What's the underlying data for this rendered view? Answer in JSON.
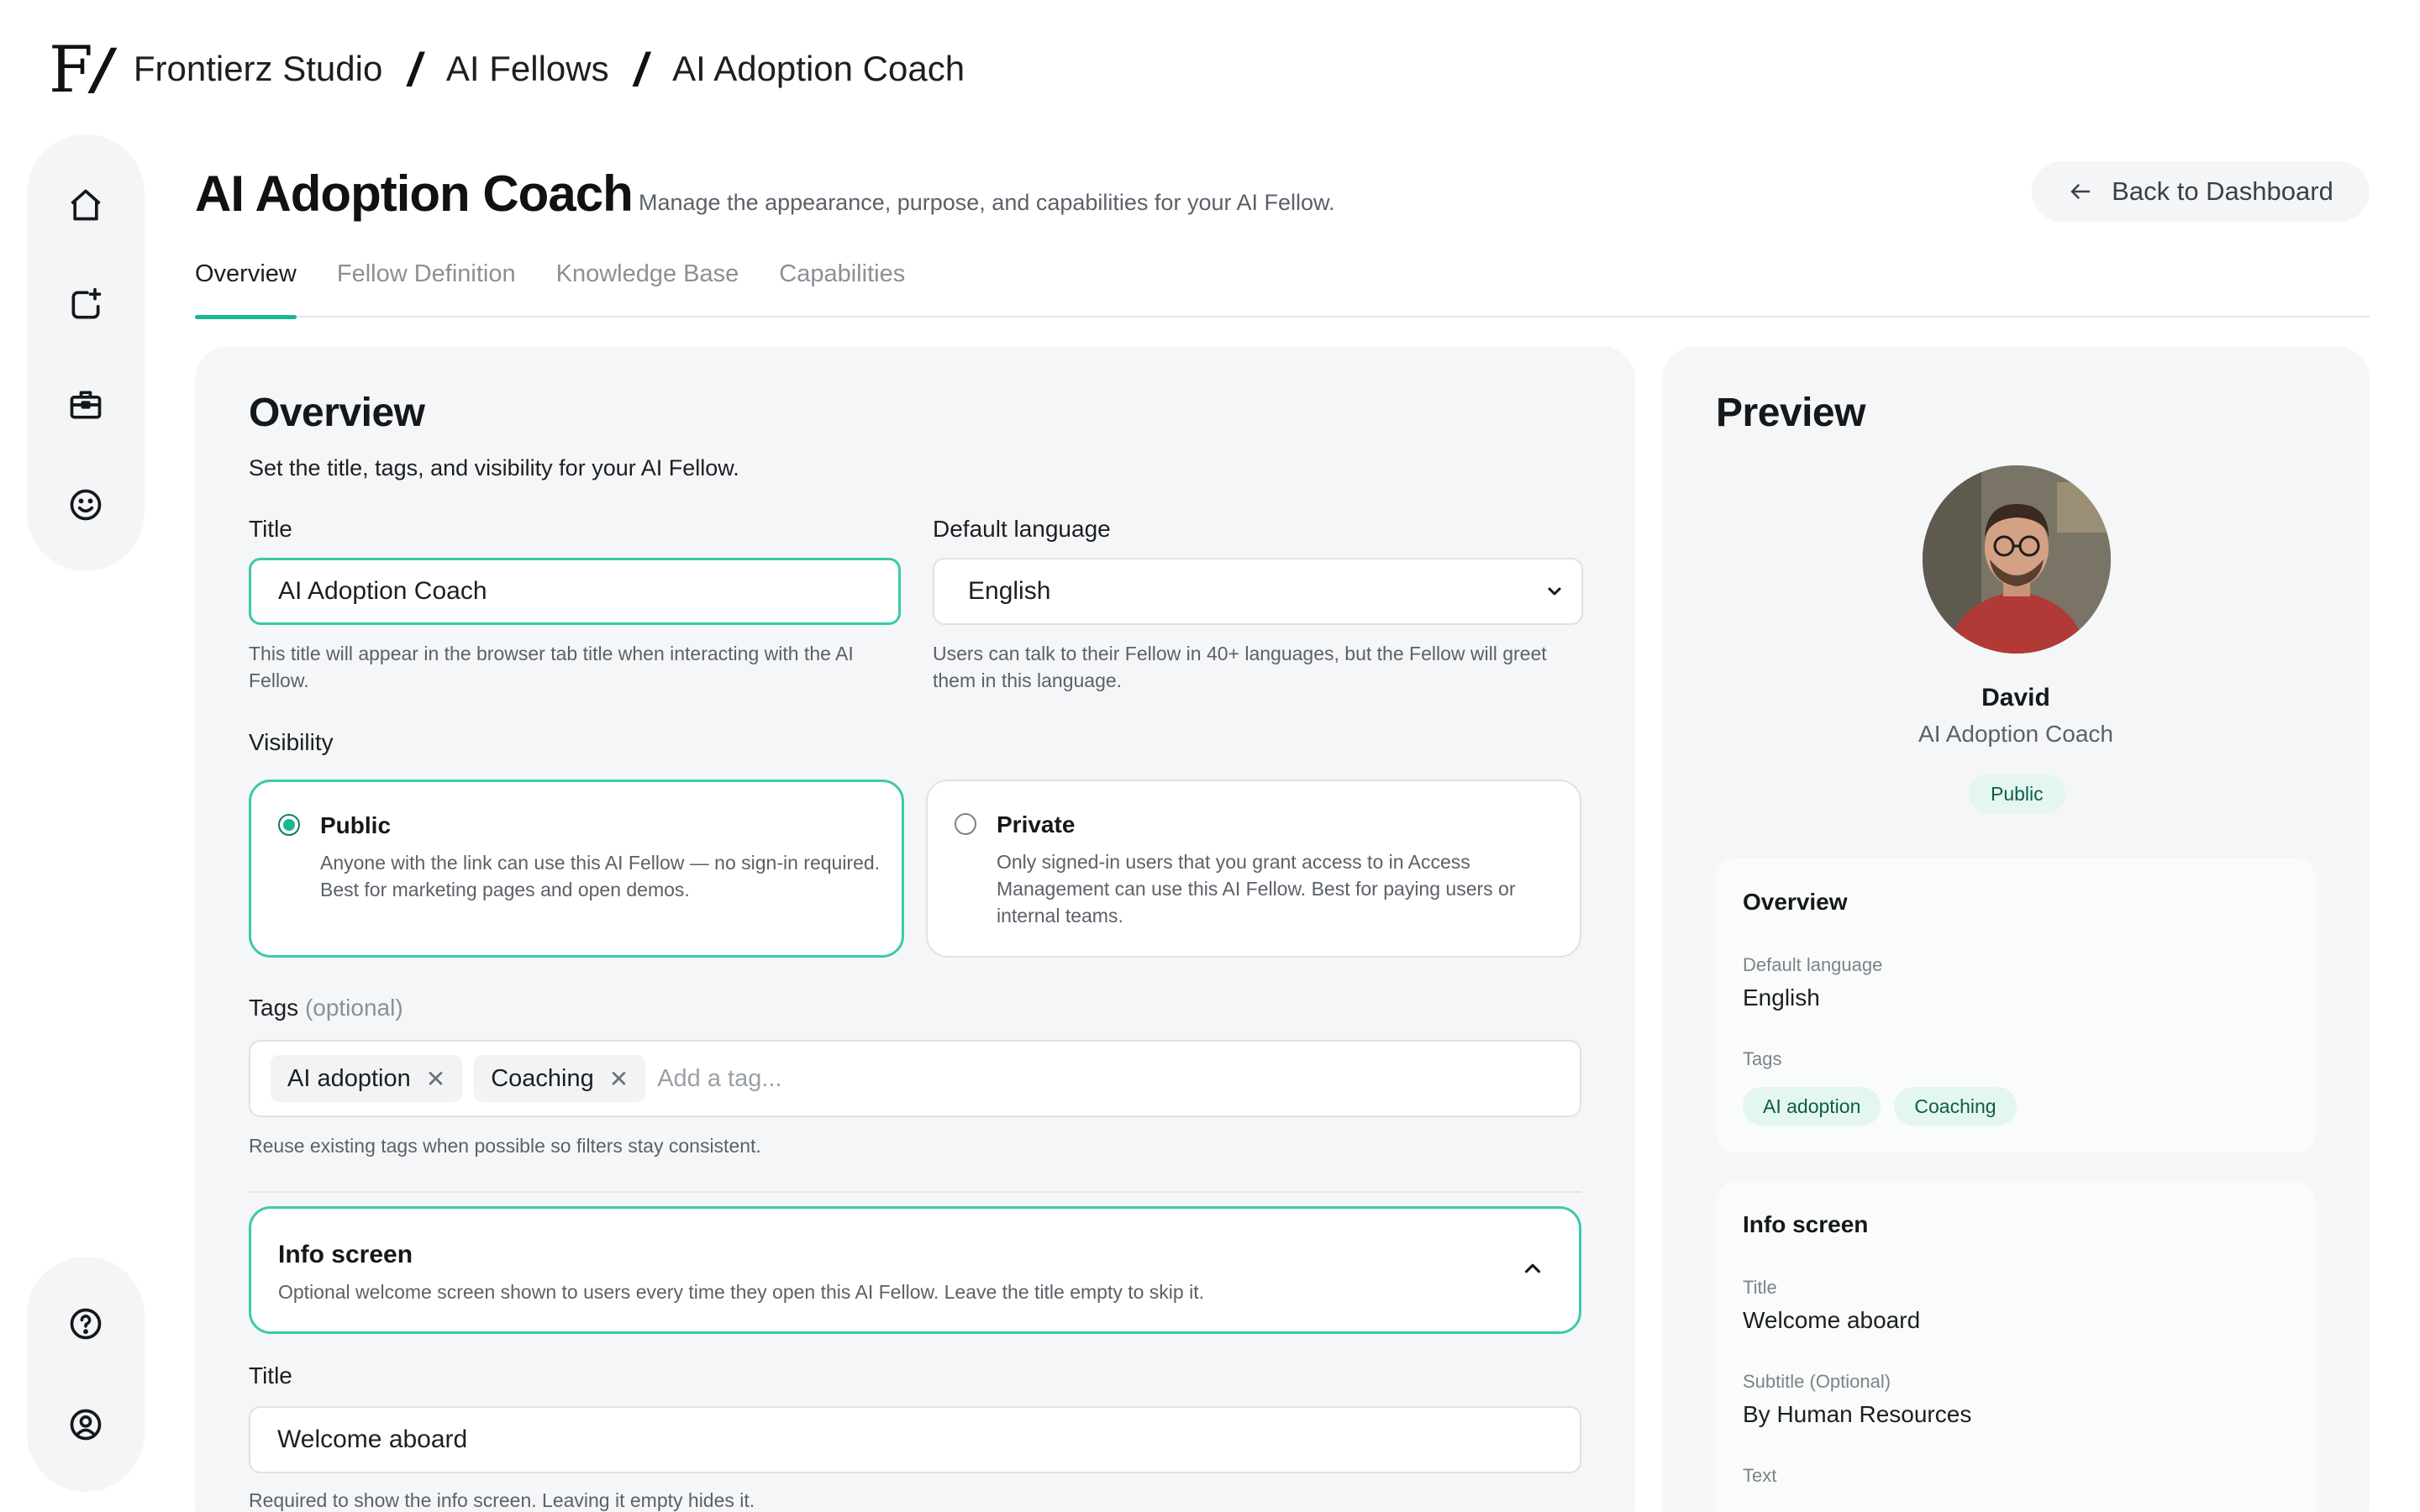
{
  "breadcrumb": {
    "logo": "F",
    "items": [
      "Frontierz Studio",
      "AI Fellows",
      "AI Adoption Coach"
    ]
  },
  "sidebar": {
    "top": [
      "home-icon",
      "new-fellow-icon",
      "briefcase-icon",
      "smiley-icon"
    ],
    "bottom": [
      "help-icon",
      "account-icon"
    ]
  },
  "header": {
    "title": "AI Adoption Coach",
    "subtitle": "Manage the appearance, purpose, and capabilities for your AI Fellow.",
    "back_label": "Back to Dashboard"
  },
  "tabs": [
    {
      "label": "Overview",
      "active": true
    },
    {
      "label": "Fellow Definition",
      "active": false
    },
    {
      "label": "Knowledge Base",
      "active": false
    },
    {
      "label": "Capabilities",
      "active": false
    }
  ],
  "overview": {
    "title": "Overview",
    "description": "Set the title, tags, and visibility for your AI Fellow.",
    "title_label": "Title",
    "title_value": "AI Adoption Coach",
    "title_help": "This title will appear in the browser tab title when interacting with the AI Fellow.",
    "language_label": "Default language",
    "language_value": "English",
    "language_help": "Users can talk to their Fellow in 40+ languages, but the Fellow will greet them in this language.",
    "visibility_label": "Visibility",
    "visibility": [
      {
        "name": "Public",
        "description": "Anyone with the link can use this AI Fellow — no sign-in required. Best for marketing pages and open demos.",
        "selected": true
      },
      {
        "name": "Private",
        "description": "Only signed-in users that you grant access to in Access Management can use this AI Fellow. Best for paying users or internal teams.",
        "selected": false
      }
    ],
    "tags_label": "Tags",
    "tags_optional": "(optional)",
    "tags": [
      "AI adoption",
      "Coaching"
    ],
    "tag_placeholder": "Add a tag...",
    "tags_help": "Reuse existing tags when possible so filters stay consistent.",
    "info_screen": {
      "title": "Info screen",
      "description": "Optional welcome screen shown to users every time they open this AI Fellow. Leave the title empty to skip it."
    },
    "info_title_label": "Title",
    "info_title_value": "Welcome aboard",
    "info_title_help": "Required to show the info screen. Leaving it empty hides it."
  },
  "preview": {
    "title": "Preview",
    "name": "David",
    "role": "AI Adoption Coach",
    "visibility_badge": "Public",
    "overview_card": {
      "title": "Overview",
      "language_key": "Default language",
      "language_value": "English",
      "tags_key": "Tags",
      "tags": [
        "AI adoption",
        "Coaching"
      ]
    },
    "info_card": {
      "title": "Info screen",
      "title_key": "Title",
      "title_value": "Welcome aboard",
      "subtitle_key": "Subtitle (Optional)",
      "subtitle_value": "By Human Resources",
      "text_key": "Text"
    }
  },
  "colors": {
    "accent": "#16b894",
    "accent_border": "#3cc9aa",
    "badge_bg": "#e3f6ef",
    "panel_bg": "#f5f6f7"
  }
}
